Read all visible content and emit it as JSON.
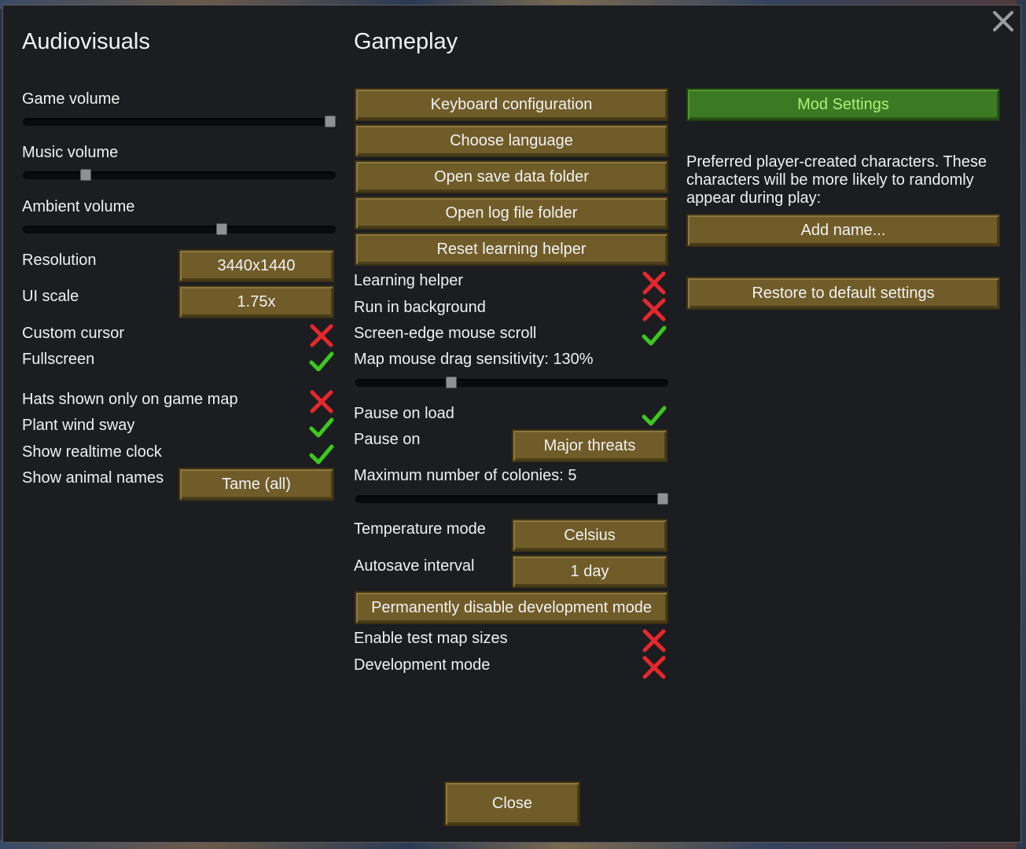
{
  "audiovisuals": {
    "heading": "Audiovisuals",
    "game_volume": {
      "label": "Game volume",
      "value": 1.0
    },
    "music_volume": {
      "label": "Music volume",
      "value": 0.19
    },
    "ambient_volume": {
      "label": "Ambient volume",
      "value": 0.64
    },
    "resolution": {
      "label": "Resolution",
      "value": "3440x1440"
    },
    "ui_scale": {
      "label": "UI scale",
      "value": "1.75x"
    },
    "custom_cursor": {
      "label": "Custom cursor",
      "checked": false
    },
    "fullscreen": {
      "label": "Fullscreen",
      "checked": true
    },
    "hats_only_map": {
      "label": "Hats shown only on game map",
      "checked": false
    },
    "plant_wind_sway": {
      "label": "Plant wind sway",
      "checked": true
    },
    "realtime_clock": {
      "label": "Show realtime clock",
      "checked": true
    },
    "animal_names": {
      "label": "Show animal names",
      "value": "Tame (all)"
    }
  },
  "gameplay": {
    "heading": "Gameplay",
    "buttons": {
      "keyboard": "Keyboard configuration",
      "language": "Choose language",
      "save_folder": "Open save data folder",
      "log_folder": "Open log file folder",
      "reset_helper": "Reset learning helper"
    },
    "learning_helper": {
      "label": "Learning helper",
      "checked": false
    },
    "run_background": {
      "label": "Run in background",
      "checked": false
    },
    "edge_scroll": {
      "label": "Screen-edge mouse scroll",
      "checked": true
    },
    "drag_sensitivity": {
      "label": "Map mouse drag sensitivity: 130%",
      "value": 0.3
    },
    "pause_on_load": {
      "label": "Pause on load",
      "checked": true
    },
    "pause_on": {
      "label": "Pause on",
      "value": "Major threats"
    },
    "max_colonies": {
      "label": "Maximum number of colonies: 5",
      "value": 1.0
    },
    "temperature_mode": {
      "label": "Temperature mode",
      "value": "Celsius"
    },
    "autosave": {
      "label": "Autosave interval",
      "value": "1 day"
    },
    "disable_dev": "Permanently disable development mode",
    "test_map_sizes": {
      "label": "Enable test map sizes",
      "checked": false
    },
    "dev_mode": {
      "label": "Development mode",
      "checked": false
    }
  },
  "right": {
    "mod_settings": "Mod Settings",
    "preferred_text": "Preferred player-created characters. These characters will be more likely to randomly appear during play:",
    "add_name": "Add name...",
    "restore_defaults": "Restore to default settings"
  },
  "footer": {
    "close": "Close"
  },
  "colors": {
    "button": "#705c29",
    "mod_button": "#3b7a22",
    "check": "#3cc81e",
    "cross": "#e6282d",
    "panel": "#1b1d20"
  }
}
